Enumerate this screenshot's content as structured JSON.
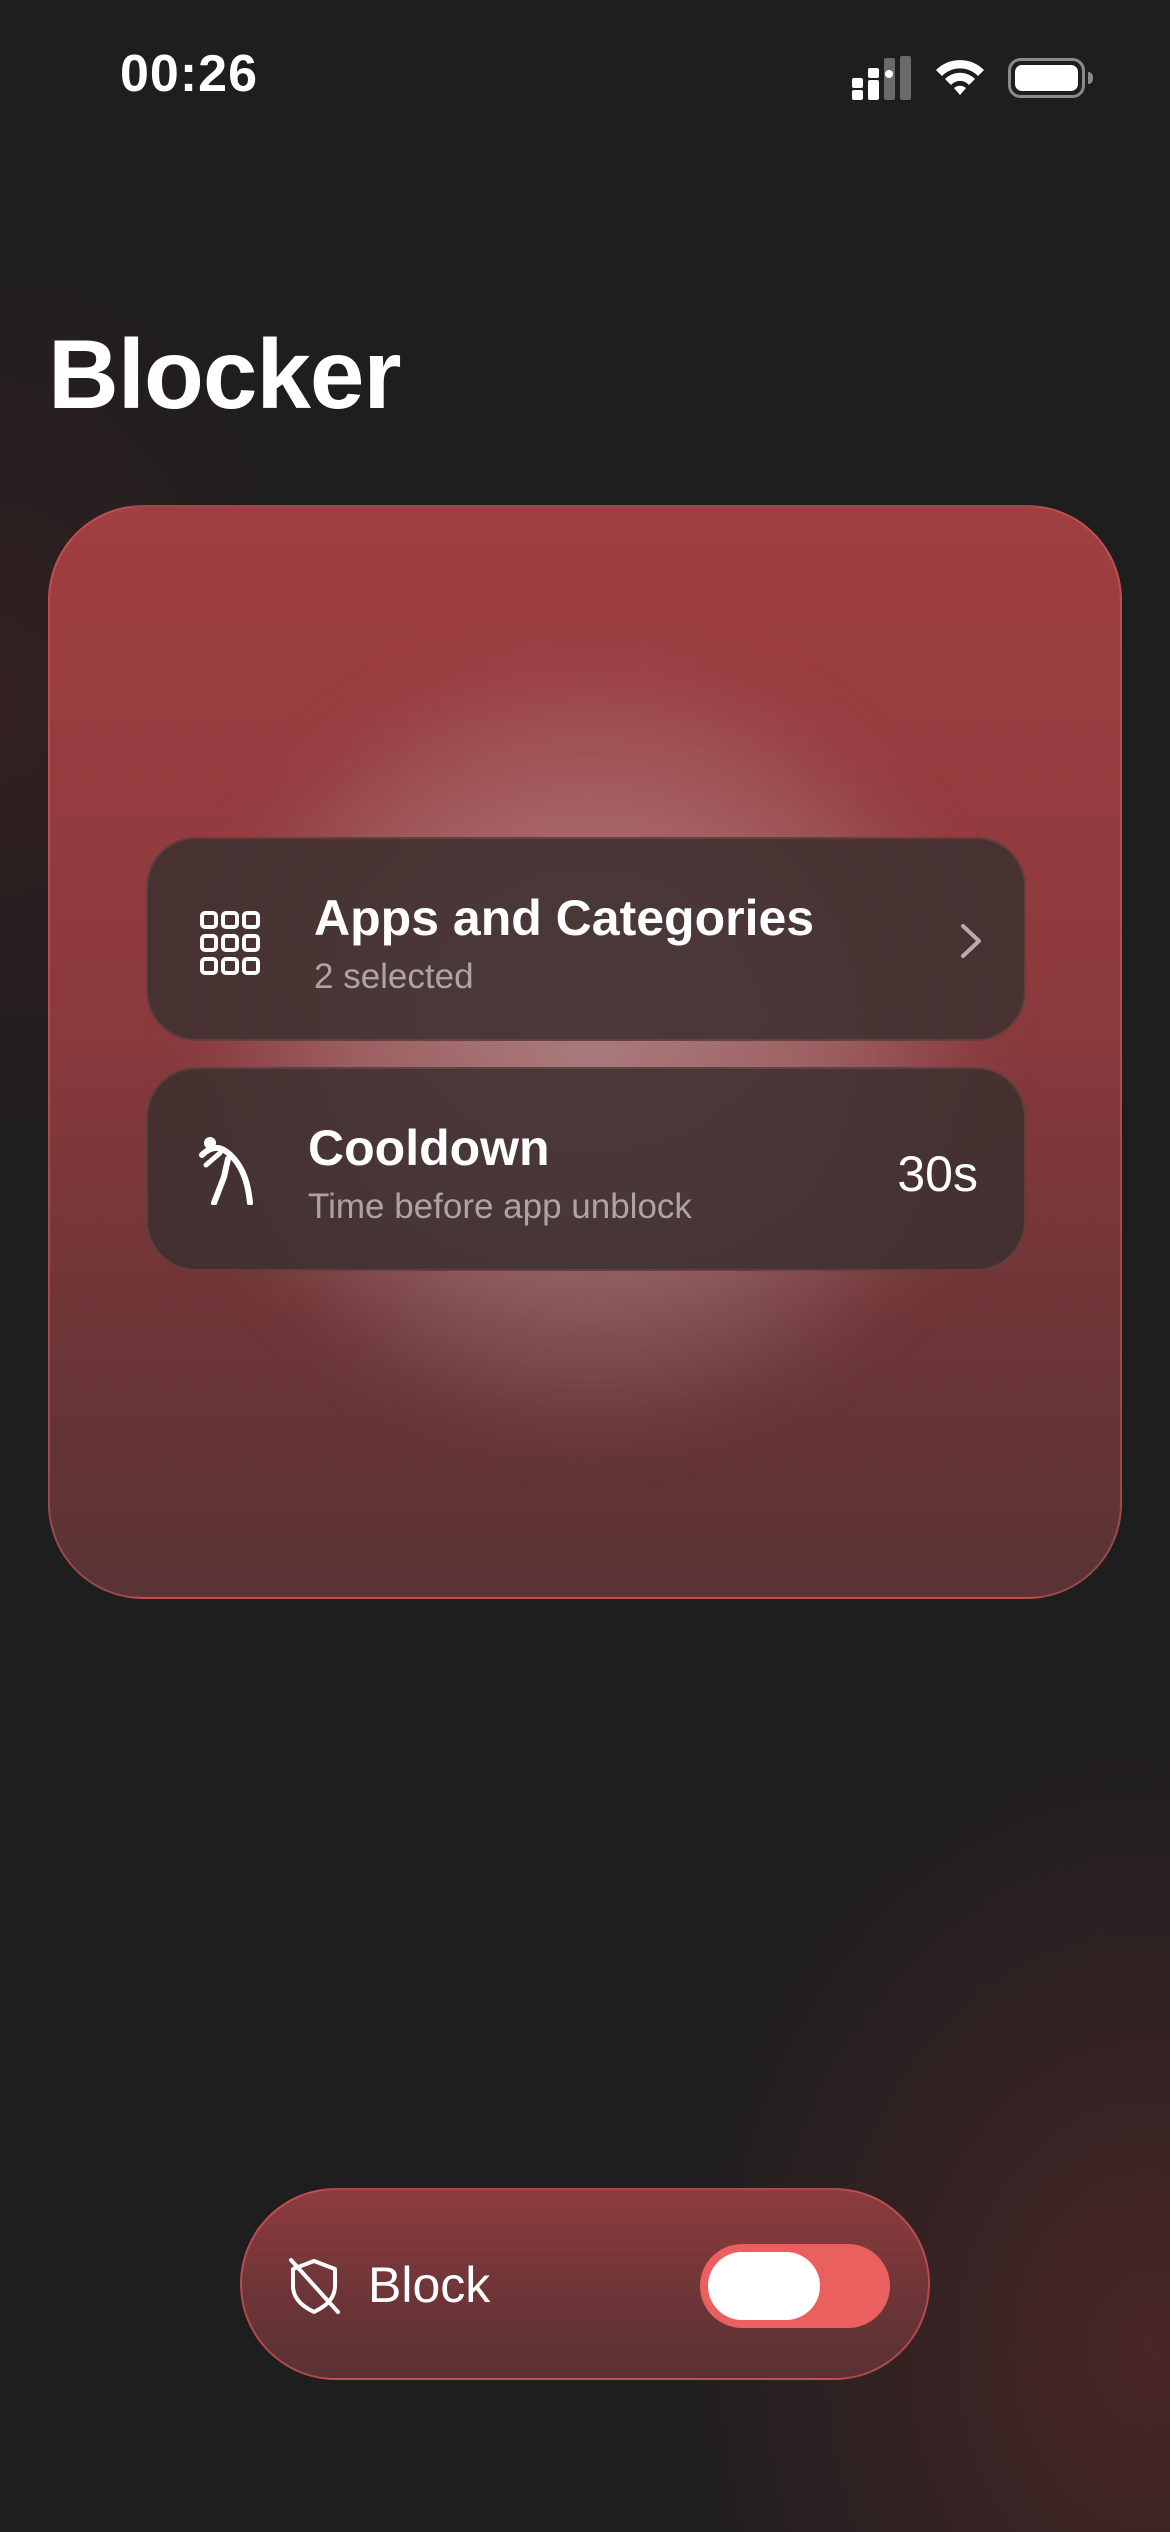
{
  "status_bar": {
    "time": "00:26",
    "icons": [
      "cellular-signal-icon",
      "wifi-icon",
      "battery-icon"
    ]
  },
  "header": {
    "title": "Blocker"
  },
  "settings": {
    "apps": {
      "icon": "app-grid-icon",
      "title": "Apps and Categories",
      "subtitle": "2 selected",
      "accessory": "chevron-right-icon"
    },
    "cooldown": {
      "icon": "stretching-figure-icon",
      "title": "Cooldown",
      "subtitle": "Time before app unblock",
      "value": "30s"
    }
  },
  "block_control": {
    "icon": "shield-slash-icon",
    "label": "Block",
    "toggle_on": true
  },
  "colors": {
    "background": "#1e1e1f",
    "accent": "#e9605f",
    "card": "#a03f42",
    "row": "#3e3030"
  }
}
